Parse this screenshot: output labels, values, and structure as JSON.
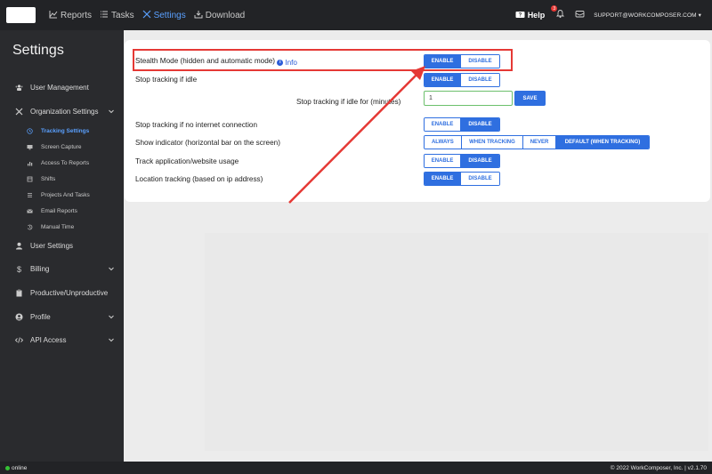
{
  "topnav": {
    "items": [
      {
        "label": "Reports",
        "icon": "chart-icon"
      },
      {
        "label": "Tasks",
        "icon": "list-icon"
      },
      {
        "label": "Settings",
        "icon": "tools-icon"
      },
      {
        "label": "Download",
        "icon": "download-icon"
      }
    ],
    "help_label": "Help",
    "notification_count": "3",
    "user_email": "SUPPORT@WORKCOMPOSER.COM"
  },
  "sidebar": {
    "title": "Settings",
    "items": [
      {
        "label": "User Management",
        "icon": "users-icon"
      },
      {
        "label": "Organization Settings",
        "icon": "wrench-icon"
      },
      {
        "label": "User Settings",
        "icon": "user-icon"
      },
      {
        "label": "Billing",
        "icon": "dollar-icon"
      },
      {
        "label": "Productive/Unproductive",
        "icon": "clipboard-icon"
      },
      {
        "label": "Profile",
        "icon": "profile-icon"
      },
      {
        "label": "API Access",
        "icon": "code-icon"
      }
    ],
    "subitems": [
      {
        "label": "Tracking Settings",
        "icon": "clock-icon"
      },
      {
        "label": "Screen Capture",
        "icon": "monitor-icon"
      },
      {
        "label": "Access To Reports",
        "icon": "bar-chart-icon"
      },
      {
        "label": "Shifts",
        "icon": "shifts-icon"
      },
      {
        "label": "Projects And Tasks",
        "icon": "tasks-icon"
      },
      {
        "label": "Email Reports",
        "icon": "email-icon"
      },
      {
        "label": "Manual Time",
        "icon": "history-icon"
      }
    ]
  },
  "settings": {
    "stealth": {
      "label": "Stealth Mode (hidden and automatic mode)",
      "info": "Info",
      "options": [
        "ENABLE",
        "DISABLE"
      ],
      "selected": "ENABLE"
    },
    "idle": {
      "label": "Stop tracking if idle",
      "options": [
        "ENABLE",
        "DISABLE"
      ],
      "selected": "ENABLE"
    },
    "idle_for": {
      "label": "Stop tracking if idle for (minutes)",
      "value": "1",
      "save": "SAVE"
    },
    "no_internet": {
      "label": "Stop tracking if no internet connection",
      "options": [
        "ENABLE",
        "DISABLE"
      ],
      "selected": "DISABLE"
    },
    "indicator": {
      "label": "Show indicator (horizontal bar on the screen)",
      "options": [
        "ALWAYS",
        "WHEN TRACKING",
        "NEVER",
        "DEFAULT (WHEN TRACKING)"
      ],
      "selected": "DEFAULT (WHEN TRACKING)"
    },
    "app_usage": {
      "label": "Track application/website usage",
      "options": [
        "ENABLE",
        "DISABLE"
      ],
      "selected": "DISABLE"
    },
    "location": {
      "label": "Location tracking (based on ip address)",
      "options": [
        "ENABLE",
        "DISABLE"
      ],
      "selected": "ENABLE"
    }
  },
  "footer": {
    "status": "online",
    "copyright": "© 2022 WorkComposer, Inc. | v2.1.70"
  },
  "colors": {
    "accent": "#2f6fe0",
    "highlight": "#e53935",
    "nav_bg": "#222326",
    "sidebar_bg": "#2a2b2e"
  }
}
